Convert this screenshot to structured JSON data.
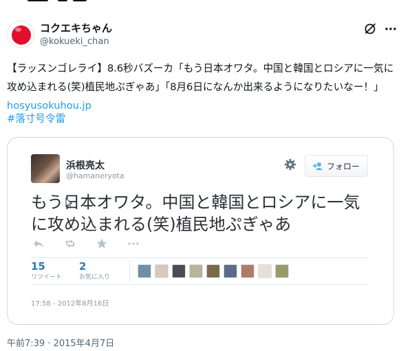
{
  "tweet": {
    "display_name": "コクエキちゃん",
    "handle": "@kokueki_chan",
    "text_main": "【ラッスンゴレライ】8.6秒バズーカ「もう日本オワタ。中国と韓国とロシアに一気に攻め込まれる(笑)植民地ぷぎゃあ」「8月6日になんか出来るようになりたいなー！」 ",
    "link": "hosyusokuhou.jp",
    "hashtag": "#落寸号令雷",
    "timestamp": "午前7:39 · 2015年4月7日"
  },
  "embedded": {
    "name": "浜根亮太",
    "handle": "@hamaneryota",
    "follow_label": "フォロー",
    "text": "もう日本オワタ。中国と韓国とロシアに一気に攻め込まれる(笑)植民地ぷぎゃあ",
    "retweets": {
      "count": "15",
      "label": "リツイート"
    },
    "favorites": {
      "count": "2",
      "label": "お気に入り"
    },
    "date": "17:58 - 2012年8月16日",
    "favoriter_avatars": [
      "#6f8fa8",
      "#d9c8c0",
      "#4a4a52",
      "#b9b39a",
      "#7a6a4a",
      "#5a6c8a",
      "#b07a6a",
      "#e8e0d8",
      "#9a9a6a"
    ]
  },
  "colors": {
    "link": "#1d9bf0",
    "stat": "#2b7bb9",
    "flag_red": "#e0102a"
  },
  "icons": {
    "grok": "grok-icon",
    "more": "more-icon",
    "gear": "gear-icon",
    "reply": "reply-icon",
    "retweet": "retweet-icon",
    "favorite": "star-icon",
    "overflow": "more-dots-icon"
  }
}
